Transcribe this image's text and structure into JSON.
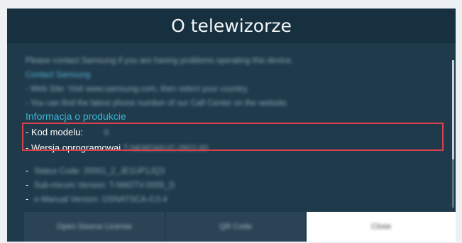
{
  "dialog": {
    "title": "O telewizorze"
  },
  "info": {
    "intro": "Please contact Samsung if you are having problems operating this device.",
    "contact_heading": "Contact Samsung",
    "web_site": "- Web Site: Visit www.samsung.com, then select your country.",
    "call_center": "- You can find the latest phone number of our Call Center on the website.",
    "section_heading": "Informacja o produkcie",
    "model_code_label": "- Kod modelu:",
    "model_code_value": "0",
    "software_label": "- Wersja oprogramowai",
    "software_value": "T-NKM2AKUC-0922.60",
    "status_code": "Status Code: 20001_2_JE1UP1JQ3",
    "sub_micom": "Sub-micom Version: T-NM2TV-0005_D",
    "emanual": "e-Manual Version: OSNATSCA-0.0.4",
    "dash": "-"
  },
  "buttons": {
    "open_source": "Open Source License",
    "qr_code": "QR Code",
    "close": "Close"
  },
  "colors": {
    "panel": "#1f3a4b",
    "title_bar": "#16303f",
    "section": "#39b6d6",
    "highlight": "#d9424c"
  }
}
